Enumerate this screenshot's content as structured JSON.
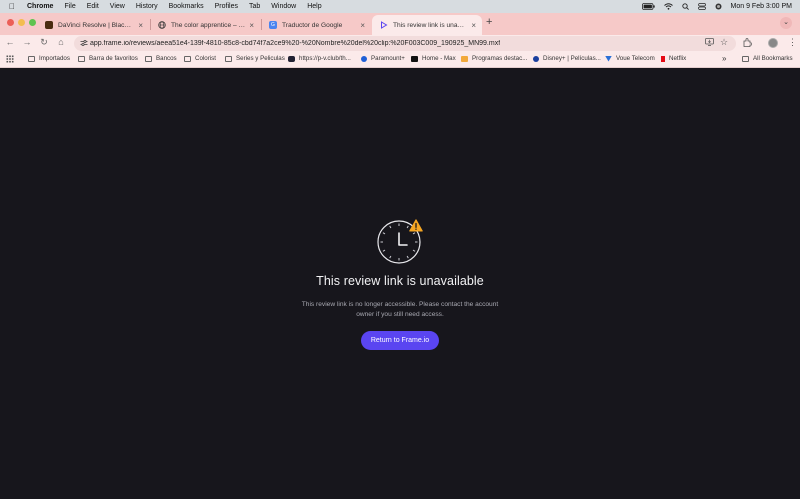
{
  "menubar": {
    "app": "Chrome",
    "items": [
      "File",
      "Edit",
      "View",
      "History",
      "Bookmarks",
      "Profiles",
      "Tab",
      "Window",
      "Help"
    ],
    "clock": "Mon 9 Feb  3:00 PM"
  },
  "tabs": [
    {
      "title": "DaVinci Resolve | Blackmagic",
      "close": "×"
    },
    {
      "title": "The color apprentice – Co",
      "close": "×"
    },
    {
      "title": "Traductor de Google",
      "close": "×"
    },
    {
      "title": "This review link is unavailable",
      "close": "×"
    }
  ],
  "newtab": "+",
  "tab_menu": "⌄",
  "address": {
    "url": "app.frame.io/reviews/aeea51e4-139f-4810-85c8-cbd74f7a2ce9%20-%20Nombre%20del%20clip:%20F003C009_190925_MN99.mxf"
  },
  "nav": {
    "back": "←",
    "forward": "→",
    "reload": "↻",
    "home": "⌂"
  },
  "bookmarks": [
    {
      "label": "Importados",
      "icon": "folder-icon"
    },
    {
      "label": "Barra de favoritos",
      "icon": "folder-icon"
    },
    {
      "label": "Bancos",
      "icon": "folder-icon"
    },
    {
      "label": "Colorist",
      "icon": "folder-icon"
    },
    {
      "label": "Series y Peliculas",
      "icon": "folder-icon"
    },
    {
      "label": "https://p-v.club/th...",
      "icon": "site-icon"
    },
    {
      "label": "Paramount+",
      "icon": "paramount-icon"
    },
    {
      "label": "Home - Max",
      "icon": "max-icon"
    },
    {
      "label": "Programas destac...",
      "icon": "site-icon"
    },
    {
      "label": "Disney+ | Películas...",
      "icon": "disney-icon"
    },
    {
      "label": "Voue Telecom",
      "icon": "voue-icon"
    },
    {
      "label": "Netflix",
      "icon": "netflix-icon"
    }
  ],
  "bookmarks_more": "»",
  "all_bookmarks": "All Bookmarks",
  "content": {
    "heading": "This review link is unavailable",
    "message": "This review link is no longer accessible. Please contact the account owner if you still need access.",
    "button": "Return to Frame.io"
  },
  "colors": {
    "accent": "#5a45f1",
    "background": "#17161c",
    "warning": "#f5a623"
  }
}
